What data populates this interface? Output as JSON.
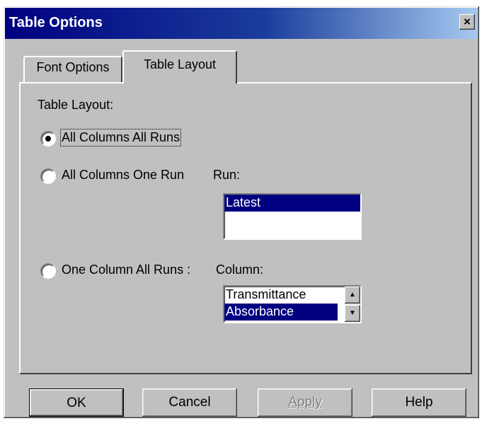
{
  "window": {
    "title": "Table Options",
    "close_icon": "×"
  },
  "tabs": [
    {
      "label": "Font Options",
      "active": false
    },
    {
      "label": "Table Layout",
      "active": true
    }
  ],
  "layout": {
    "heading": "Table Layout:",
    "options": [
      {
        "label": "All Columns  All Runs",
        "selected": true
      },
      {
        "label": "All Columns One Run",
        "selected": false
      },
      {
        "label": "One Column All Runs :",
        "selected": false
      }
    ]
  },
  "run": {
    "label": "Run:",
    "items": [
      {
        "label": "Latest",
        "selected": true
      }
    ]
  },
  "column": {
    "label": "Column:",
    "items": [
      {
        "label": "Transmittance",
        "selected": false
      },
      {
        "label": "Absorbance",
        "selected": true
      }
    ]
  },
  "buttons": {
    "ok": "OK",
    "cancel": "Cancel",
    "apply": "Apply",
    "help": "Help"
  },
  "colors": {
    "selection": "#000080",
    "face": "#c0c0c0"
  }
}
